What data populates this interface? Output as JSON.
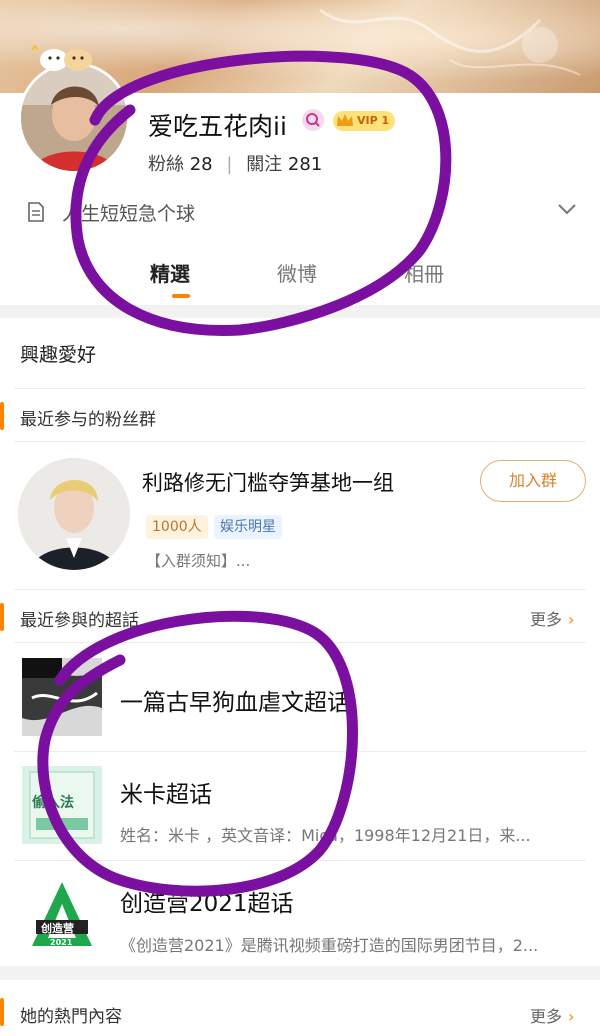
{
  "profile": {
    "name": "爱吃五花肉ii",
    "vip_label": "VIP 1",
    "fans_label": "粉絲",
    "fans_count": "28",
    "follow_label": "關注",
    "follow_count": "281",
    "bio": "人生短短急个球"
  },
  "tabs": [
    {
      "label": "精選",
      "active": true
    },
    {
      "label": "微博",
      "active": false
    },
    {
      "label": "相冊",
      "active": false
    }
  ],
  "interests": {
    "title": "興趣愛好"
  },
  "fan_groups": {
    "title": "最近参与的粉丝群",
    "group": {
      "name": "利路修无门槛夺笋基地一组",
      "join_label": "加入群",
      "member_count": "1000人",
      "category": "娱乐明星",
      "notice": "【入群须知】..."
    }
  },
  "super_topics": {
    "title": "最近參與的超話",
    "more_label": "更多",
    "items": [
      {
        "title": "一篇古早狗血虐文超话",
        "desc": ""
      },
      {
        "title": "米卡超话",
        "desc": "姓名：米卡 ，英文音译：Mica，1998年12月21日，来..."
      },
      {
        "title": "创造营2021超话",
        "desc": "《创造营2021》是腾讯视频重磅打造的国际男团节目，2..."
      }
    ],
    "logo_text": "创造营",
    "logo_year": "2021",
    "book_text": "偷入法"
  },
  "hot_content": {
    "title": "她的熱門內容",
    "more_label": "更多"
  },
  "colors": {
    "accent": "#ff8200",
    "annotation_purple": "#7a0fa0"
  }
}
